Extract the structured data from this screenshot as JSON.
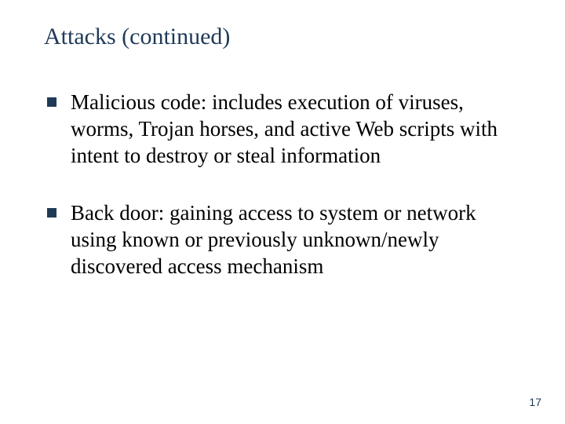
{
  "slide": {
    "title": "Attacks (continued)",
    "bullets": [
      "Malicious code: includes execution of viruses, worms, Trojan horses, and active Web scripts with intent to destroy or steal information",
      "Back door: gaining access to system or network using known or previously unknown/newly discovered access mechanism"
    ],
    "page_number": "17"
  },
  "colors": {
    "title_color": "#1f3a57",
    "body_color": "#000000",
    "bullet_color": "#1f3a57"
  }
}
